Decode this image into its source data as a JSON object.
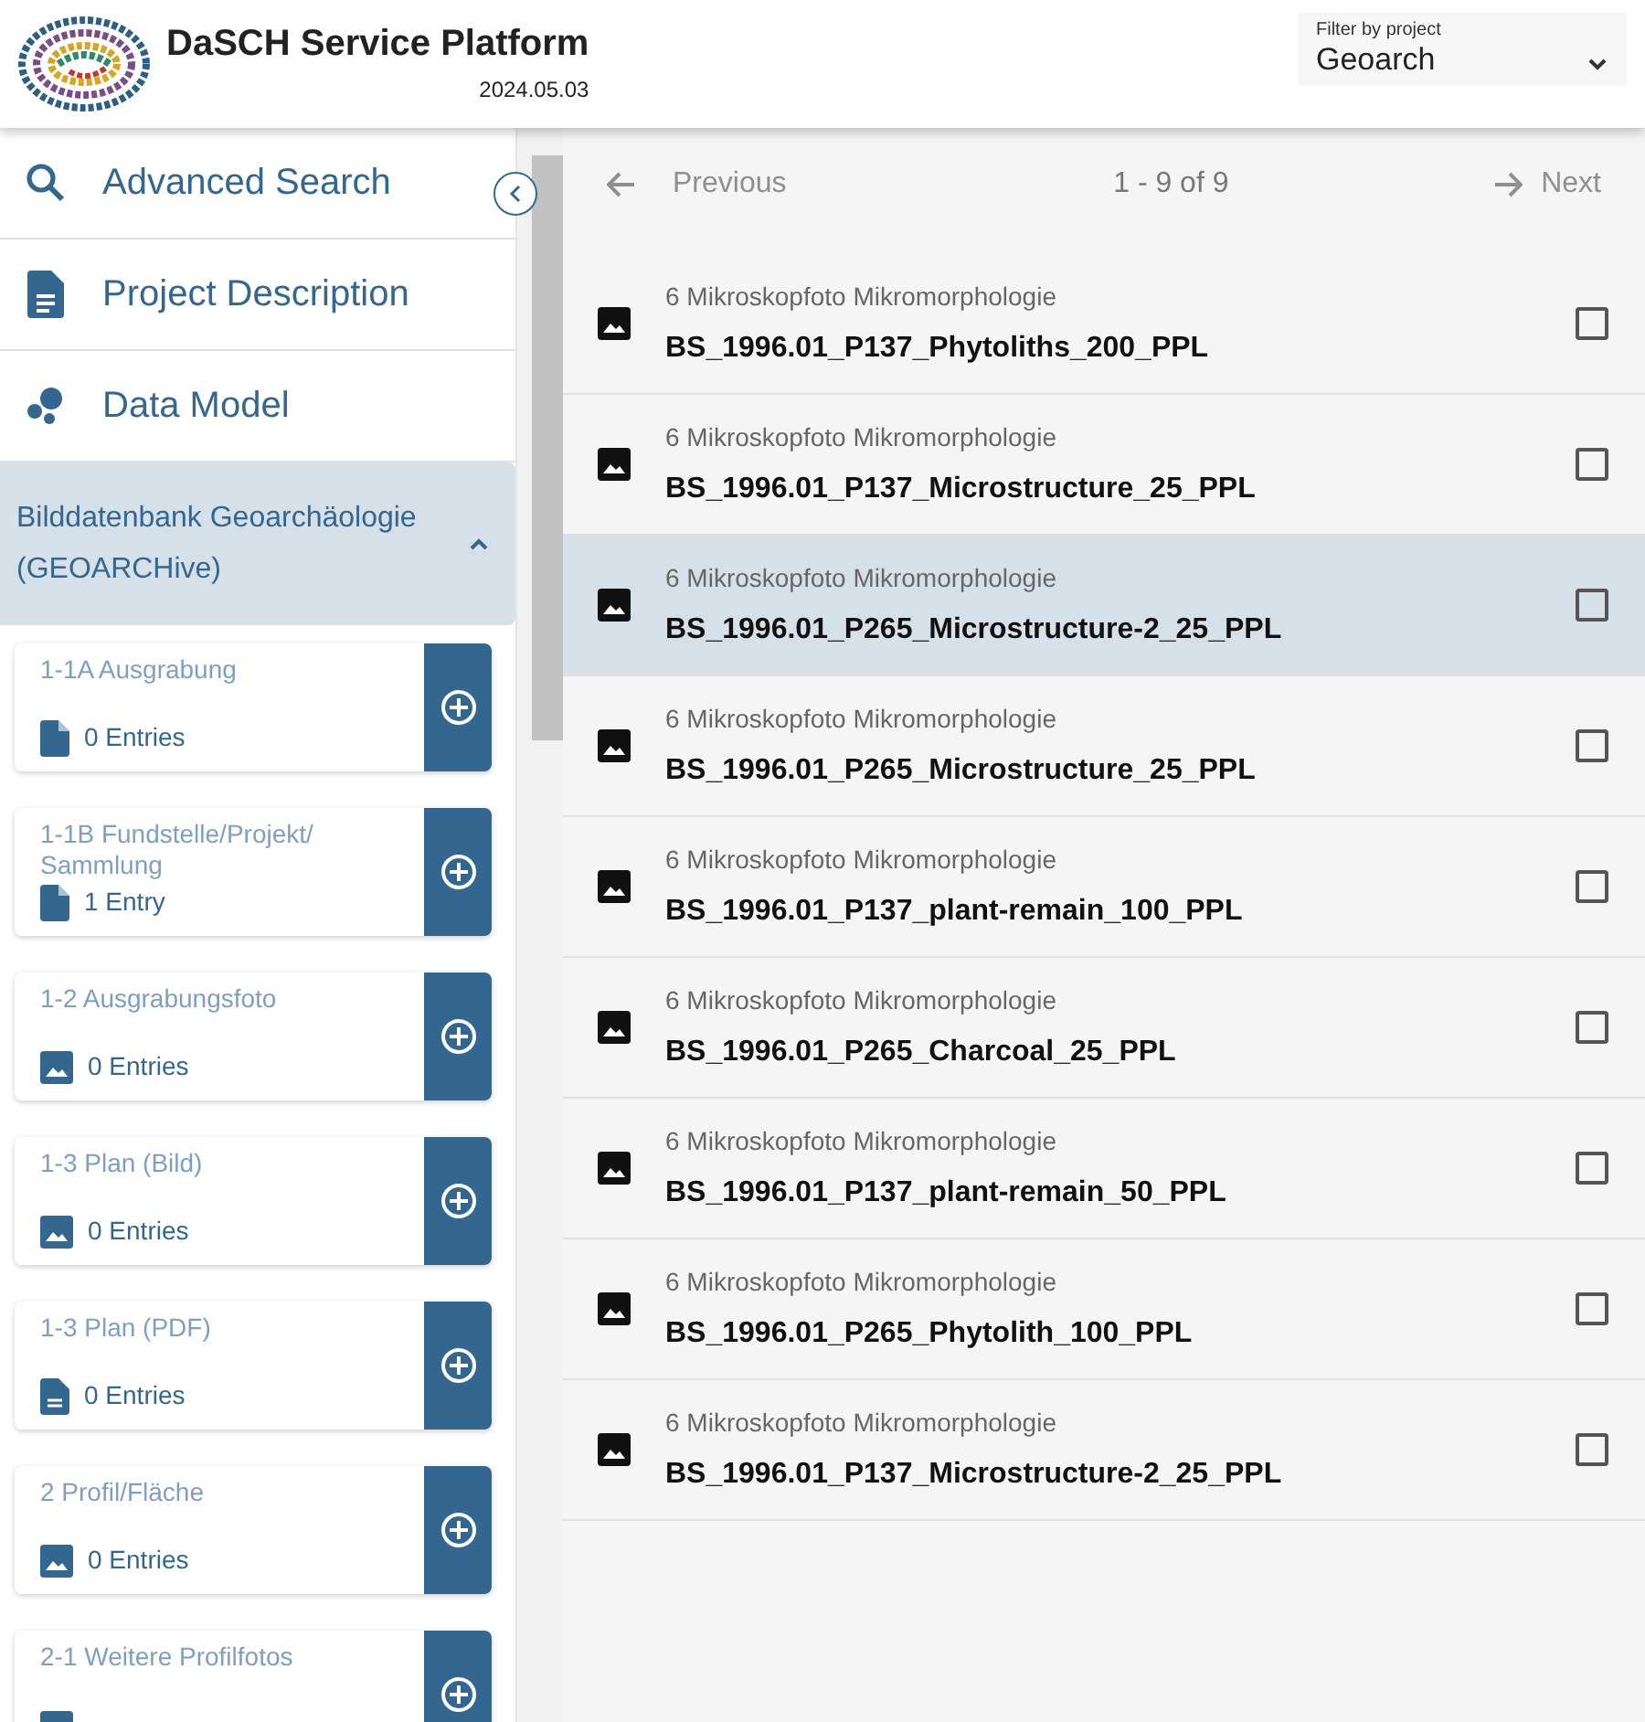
{
  "header": {
    "title": "DaSCH Service Platform",
    "version": "2024.05.03",
    "filter": {
      "label": "Filter by project",
      "value": "Geoarch"
    }
  },
  "sidebar": {
    "nav": [
      {
        "label": "Advanced Search",
        "kind": "search"
      },
      {
        "label": "Project Description",
        "kind": "description"
      },
      {
        "label": "Data Model",
        "kind": "model"
      }
    ],
    "group": {
      "title": "Bilddatenbank Geoarchäologie (GEOARCHive)",
      "expanded": true
    },
    "classes": [
      {
        "name": "1-1A Ausgrabung",
        "count": "0 Entries",
        "kind": "file"
      },
      {
        "name": "1-1B Fundstelle/Projekt/ Sammlung",
        "count": "1 Entry",
        "kind": "file"
      },
      {
        "name": "1-2 Ausgrabungsfoto",
        "count": "0 Entries",
        "kind": "image"
      },
      {
        "name": "1-3 Plan (Bild)",
        "count": "0 Entries",
        "kind": "image"
      },
      {
        "name": "1-3 Plan (PDF)",
        "count": "0 Entries",
        "kind": "document"
      },
      {
        "name": "2 Profil/Fläche",
        "count": "0 Entries",
        "kind": "image"
      },
      {
        "name": "2-1 Weitere Profilfotos",
        "kind": "image"
      }
    ]
  },
  "pagination": {
    "previous": "Previous",
    "range": "1 - 9 of 9",
    "next": "Next",
    "previous_disabled": true,
    "next_disabled": true
  },
  "results": [
    {
      "type": "6 Mikroskopfoto Mikromorphologie",
      "label": "BS_1996.01_P137_Phytoliths_200_PPL",
      "selected": false,
      "checked": false
    },
    {
      "type": "6 Mikroskopfoto Mikromorphologie",
      "label": "BS_1996.01_P137_Microstructure_25_PPL",
      "selected": false,
      "checked": false
    },
    {
      "type": "6 Mikroskopfoto Mikromorphologie",
      "label": "BS_1996.01_P265_Microstructure-2_25_PPL",
      "selected": true,
      "checked": false
    },
    {
      "type": "6 Mikroskopfoto Mikromorphologie",
      "label": "BS_1996.01_P265_Microstructure_25_PPL",
      "selected": false,
      "checked": false
    },
    {
      "type": "6 Mikroskopfoto Mikromorphologie",
      "label": "BS_1996.01_P137_plant-remain_100_PPL",
      "selected": false,
      "checked": false
    },
    {
      "type": "6 Mikroskopfoto Mikromorphologie",
      "label": "BS_1996.01_P265_Charcoal_25_PPL",
      "selected": false,
      "checked": false
    },
    {
      "type": "6 Mikroskopfoto Mikromorphologie",
      "label": "BS_1996.01_P137_plant-remain_50_PPL",
      "selected": false,
      "checked": false
    },
    {
      "type": "6 Mikroskopfoto Mikromorphologie",
      "label": "BS_1996.01_P265_Phytolith_100_PPL",
      "selected": false,
      "checked": false
    },
    {
      "type": "6 Mikroskopfoto Mikromorphologie",
      "label": "BS_1996.01_P137_Microstructure-2_25_PPL",
      "selected": false,
      "checked": false
    }
  ]
}
